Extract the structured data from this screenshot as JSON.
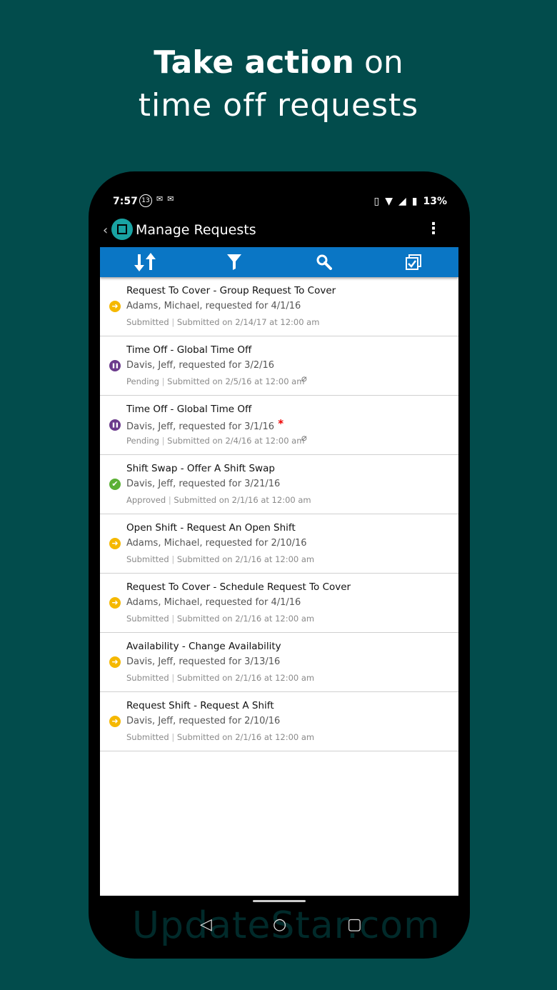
{
  "headline": {
    "bold": "Take action",
    "rest": " on",
    "line2": "time off requests"
  },
  "status_bar": {
    "time": "7:57",
    "notif_badge": "13",
    "battery": "13%"
  },
  "app_bar": {
    "title": "Manage Requests"
  },
  "toolbar": {
    "sort_icon": "sort-icon",
    "filter_icon": "filter-icon",
    "search_icon": "search-icon",
    "select_icon": "multi-select-icon"
  },
  "status_colors": {
    "Submitted": "#f5b800",
    "Pending": "#6b3a8c",
    "Approved": "#5bb035"
  },
  "requests": [
    {
      "title": "Request To Cover - Group Request To Cover",
      "subtitle": "Adams, Michael, requested for 4/1/16",
      "status": "Submitted",
      "submitted": "Submitted on 2/14/17 at 12:00 am",
      "attachment": false,
      "required": false
    },
    {
      "title": "Time Off - Global Time Off",
      "subtitle": "Davis, Jeff, requested for 3/2/16",
      "status": "Pending",
      "submitted": "Submitted on 2/5/16 at 12:00 am",
      "attachment": true,
      "required": false
    },
    {
      "title": "Time Off - Global Time Off",
      "subtitle": "Davis, Jeff, requested for 3/1/16",
      "status": "Pending",
      "submitted": "Submitted on 2/4/16 at 12:00 am",
      "attachment": true,
      "required": true
    },
    {
      "title": "Shift Swap - Offer A Shift Swap",
      "subtitle": "Davis, Jeff, requested for 3/21/16",
      "status": "Approved",
      "submitted": "Submitted on 2/1/16 at 12:00 am",
      "attachment": false,
      "required": false
    },
    {
      "title": "Open Shift - Request An Open Shift",
      "subtitle": "Adams, Michael, requested for 2/10/16",
      "status": "Submitted",
      "submitted": "Submitted on 2/1/16 at 12:00 am",
      "attachment": false,
      "required": false
    },
    {
      "title": "Request To Cover - Schedule Request To Cover",
      "subtitle": "Adams, Michael, requested for 4/1/16",
      "status": "Submitted",
      "submitted": "Submitted on 2/1/16 at 12:00 am",
      "attachment": false,
      "required": false
    },
    {
      "title": "Availability - Change Availability",
      "subtitle": "Davis, Jeff, requested for 3/13/16",
      "status": "Submitted",
      "submitted": "Submitted on 2/1/16 at 12:00 am",
      "attachment": false,
      "required": false
    },
    {
      "title": "Request Shift - Request A Shift",
      "subtitle": "Davis, Jeff, requested for 2/10/16",
      "status": "Submitted",
      "submitted": "Submitted on 2/1/16 at 12:00 am",
      "attachment": false,
      "required": false
    }
  ],
  "watermark": "UpdateStar.com"
}
